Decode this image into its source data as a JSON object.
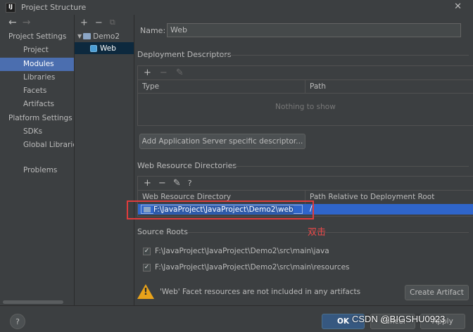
{
  "window": {
    "title": "Project Structure",
    "app_icon": "IJ",
    "close": "✕"
  },
  "nav": {
    "back": "←",
    "forward": "→"
  },
  "sidebar": {
    "project_settings_header": "Project Settings",
    "project_items": [
      "Project",
      "Modules",
      "Libraries",
      "Facets",
      "Artifacts"
    ],
    "platform_settings_header": "Platform Settings",
    "platform_items": [
      "SDKs",
      "Global Libraries"
    ],
    "problems": "Problems",
    "selected": "Modules"
  },
  "tree": {
    "toolbar": {
      "add": "+",
      "remove": "−",
      "copy": "⧉"
    },
    "root": "Demo2",
    "child": "Web"
  },
  "name_field": {
    "label": "Name:",
    "value": "Web"
  },
  "deployment": {
    "title": "Deployment Descriptors",
    "toolbar": {
      "add": "+",
      "remove": "−",
      "edit": "✎"
    },
    "columns": [
      "Type",
      "Path"
    ],
    "empty_text": "Nothing to show",
    "add_button": "Add Application Server specific descriptor..."
  },
  "web_resources": {
    "title": "Web Resource Directories",
    "toolbar": {
      "add": "+",
      "remove": "−",
      "edit": "✎",
      "help": "?"
    },
    "columns": [
      "Web Resource Directory",
      "Path Relative to Deployment Root"
    ],
    "row": {
      "directory": "F:\\JavaProject\\JavaProject\\Demo2\\web",
      "path": "/"
    }
  },
  "annotation": "双击",
  "source_roots": {
    "title": "Source Roots",
    "items": [
      {
        "path": "F:\\JavaProject\\JavaProject\\Demo2\\src\\main\\java",
        "checked": true
      },
      {
        "path": "F:\\JavaProject\\JavaProject\\Demo2\\src\\main\\resources",
        "checked": true
      }
    ]
  },
  "warning": {
    "text": "'Web' Facet resources are not included in any artifacts",
    "button": "Create Artifact"
  },
  "footer": {
    "help": "?",
    "ok": "OK",
    "cancel": "Cancel",
    "apply": "Apply"
  },
  "watermark": "CSDN @BIGSHU0923",
  "colors": {
    "selection": "#4b6eaf",
    "table_selection": "#2f65ca",
    "annotation_red": "#e03c3c",
    "warning": "#e8a21a"
  }
}
